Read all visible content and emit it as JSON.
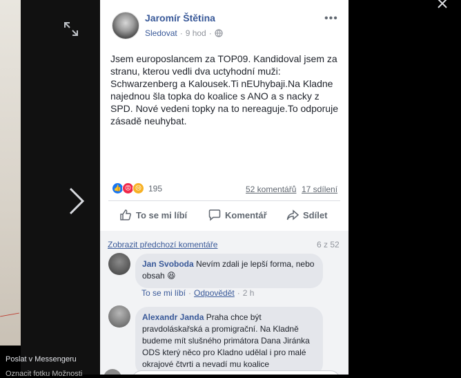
{
  "viewer": {
    "messenger_label": "Poslat v Messengeru",
    "bottom_partial": "Oznacit fotku   Možnosti",
    "icons": {
      "expand": "expand-icon",
      "next": "chevron-right-icon",
      "close": "close-icon"
    }
  },
  "post": {
    "author": "Jaromír Štětina",
    "follow_label": "Sledovat",
    "separator": "·",
    "time": "9 hod",
    "privacy_icon": "globe-icon",
    "more_icon": "more-options-icon",
    "text": "Jsem europoslancem za TOP09. Kandidoval jsem za stranu, kterou vedli dva uctyhodní muži: Schwarzenberg a Kalousek.Ti nEUhybaji.Na Kladne najednou šla topka do koalice s ANO a s nacky z SPD. Nové vedeni topky na to nereaguje.To odporuje zásadě neuhybat.",
    "reactions": {
      "icons": [
        "like-icon",
        "angry-icon",
        "sad-icon"
      ],
      "colors": [
        "#1877f2",
        "#f02849",
        "#f7b125"
      ],
      "count": "195"
    },
    "comments_count": "52 komentářů",
    "shares_count": "17 sdílení",
    "actions": {
      "like": "To se mi líbí",
      "comment": "Komentář",
      "share": "Sdílet"
    }
  },
  "comments": {
    "prev_link": "Zobrazit předchozí komentáře",
    "page_count": "6 z 52",
    "items": [
      {
        "name": "Jan Svoboda",
        "text": "Nevím zdali je lepší forma, nebo obsah 😆",
        "like": "To se mi líbí",
        "reply": "Odpovědět",
        "time": "2 h"
      },
      {
        "name": "Alexandr Janda",
        "text": "Praha chce být pravdoláskařská a promigrační. Na Kladně budeme mít slušného primátora Dana Jiránka ODS který něco pro Kladno udělal i pro malé okrajové čtvrti a nevadí mu koalice"
      }
    ]
  },
  "colors": {
    "link": "#385898",
    "muted": "#90949c",
    "bubble": "#e4e6eb",
    "comments_bg": "#f2f3f5"
  }
}
